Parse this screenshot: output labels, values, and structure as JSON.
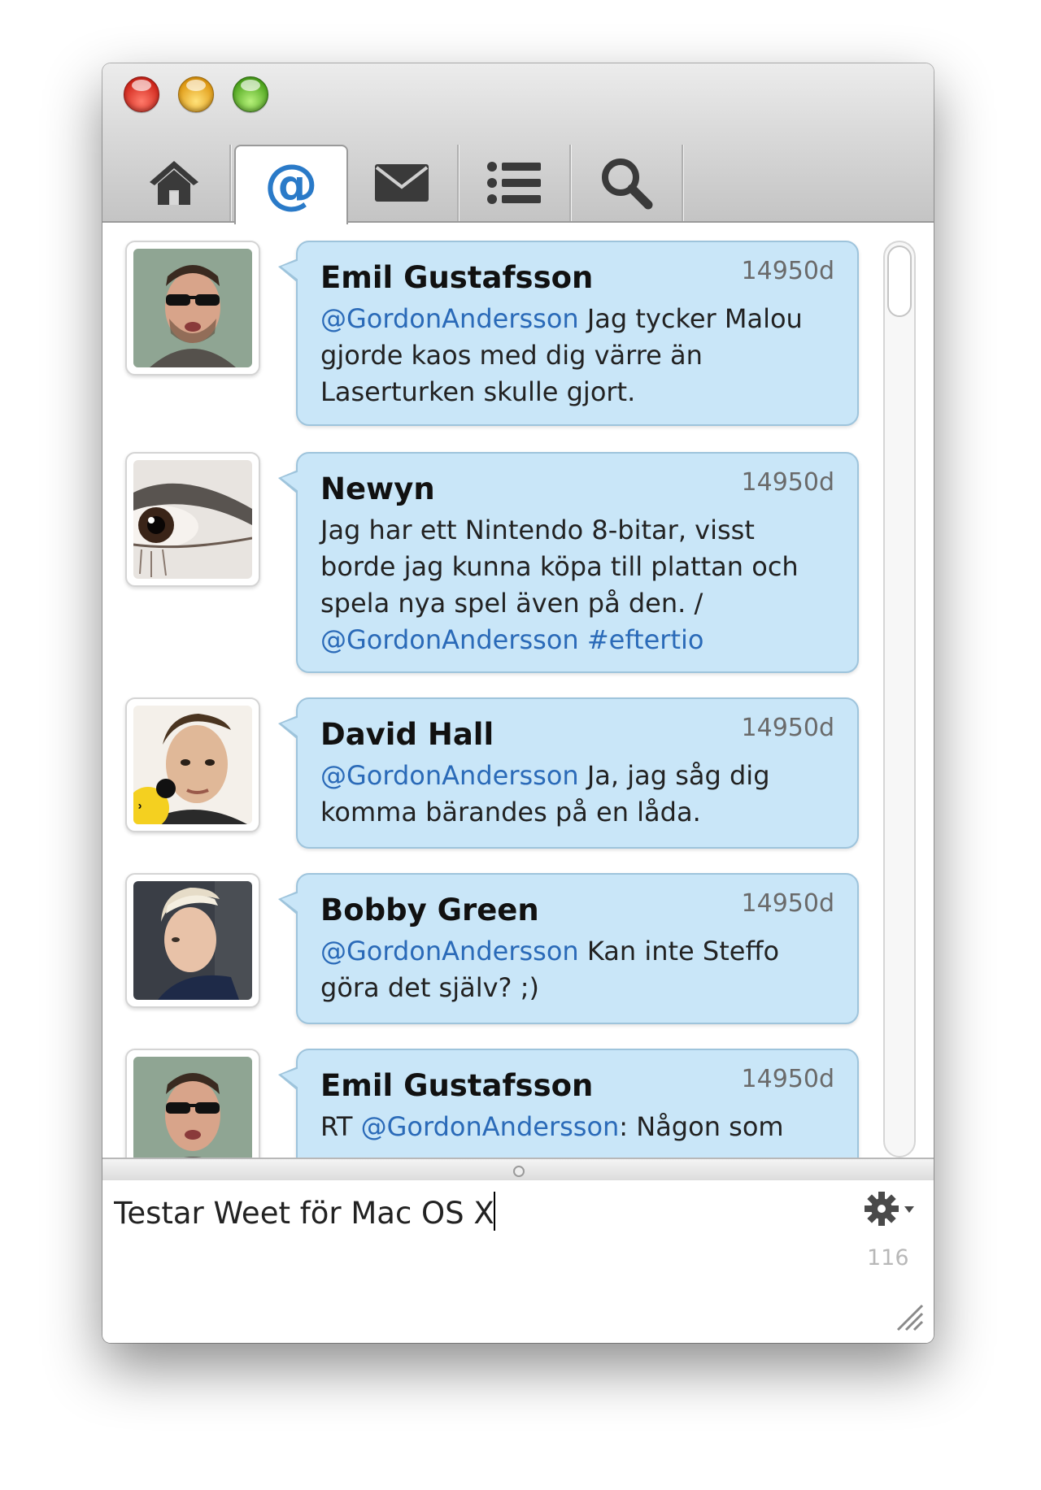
{
  "window": {
    "traffic_lights": [
      "close",
      "minimize",
      "zoom"
    ]
  },
  "tabs": [
    {
      "name": "home",
      "icon": "home-icon",
      "active": false
    },
    {
      "name": "mentions",
      "icon": "at-icon",
      "active": true
    },
    {
      "name": "messages",
      "icon": "envelope-icon",
      "active": false
    },
    {
      "name": "lists",
      "icon": "list-icon",
      "active": false
    },
    {
      "name": "search",
      "icon": "search-icon",
      "active": false
    }
  ],
  "tweets": [
    {
      "name": "Emil Gustafsson",
      "time": "14950d",
      "mention": "@GordonAndersson",
      "text": " Jag tycker Malou gjorde kaos med dig värre än Laserturken skulle gjort."
    },
    {
      "name": "Newyn",
      "time": "14950d",
      "text": "Jag har ett Nintendo 8-bitar, visst borde jag kunna köpa till plattan och spela nya spel även på den. / ",
      "mention": "@GordonAndersson #eftertio"
    },
    {
      "name": "David Hall",
      "time": "14950d",
      "mention": "@GordonAndersson",
      "text": " Ja, jag såg dig komma bärandes på en låda."
    },
    {
      "name": "Bobby Green",
      "time": "14950d",
      "mention": "@GordonAndersson",
      "text": " Kan inte Steffo göra det själv? ;)"
    },
    {
      "name": "Emil Gustafsson",
      "time": "14950d",
      "prefix": "RT ",
      "mention": "@GordonAndersson",
      "text": ": Någon som"
    }
  ],
  "compose": {
    "value": "Testar Weet för Mac OS X",
    "char_count": "116"
  },
  "colors": {
    "bubble": "#c9e6f8",
    "mention": "#2a6ab8",
    "active_tab_icon": "#2a7ac8"
  }
}
